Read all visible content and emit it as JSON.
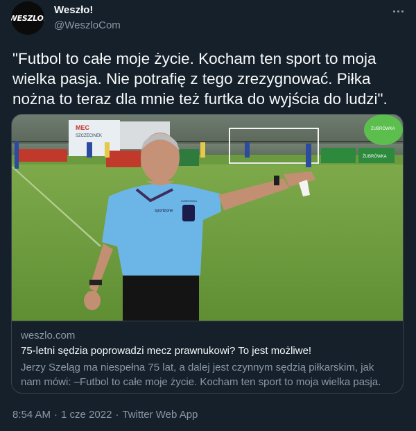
{
  "author": {
    "name": "Weszło!",
    "handle": "@WeszloCom",
    "avatar_text": "WESZLO!"
  },
  "more_icon": "more-horizontal-icon",
  "tweet": {
    "text": "\"Futbol to całe moje życie. Kocham ten sport to moja wielka pasja. Nie potrafię z tego zrezygnować. Piłka nożna to teraz dla mnie też furtka do wyjścia do ludzi\"."
  },
  "card": {
    "domain": "weszlo.com",
    "title": "75-letni sędzia poprowadzi mecz prawnukowi? To jest możliwe!",
    "description": "Jerzy Szeląg ma niespełna 75 lat, a dalej jest czynnym sędzią piłkarskim, jak nam mówi: –Futbol to całe moje życie. Kocham ten sport to moja wielka pasja. ...",
    "image": {
      "banner_mec": "MEC",
      "banner_city": "SZCZECINEK",
      "badge_text": "ŻUBRÓWKA",
      "sponsor_text": "ŻUBRÓWKA",
      "sponsor_ball_text": "ŻUBRÓWKA",
      "shirt_text": "sportzone"
    }
  },
  "meta": {
    "time": "8:54 AM",
    "separator": "·",
    "date": "1 cze 2022",
    "source": "Twitter Web App"
  },
  "colors": {
    "background": "#15202b",
    "text_primary": "#f7f9f9",
    "text_secondary": "#8b98a5",
    "border": "#38444d"
  }
}
